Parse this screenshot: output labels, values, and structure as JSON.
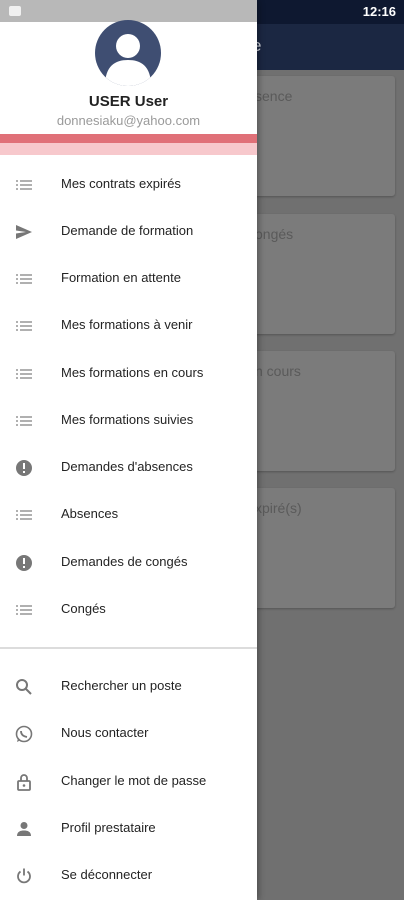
{
  "status": {
    "time": "12:16"
  },
  "app": {
    "title_fragment": "e",
    "cards": [
      {
        "title": "sence"
      },
      {
        "title": "ongés"
      },
      {
        "title": "n cours"
      },
      {
        "title": "xpiré(s)"
      }
    ]
  },
  "drawer": {
    "user_name": "USER User",
    "user_email": "donnesiaku@yahoo.com",
    "accent_colors": [
      "#e07078",
      "#f7c8cc"
    ],
    "menu": [
      {
        "label": "Mes contrats expirés",
        "icon": "list-icon"
      },
      {
        "label": "Demande de formation",
        "icon": "send-icon"
      },
      {
        "label": "Formation en attente",
        "icon": "list-icon"
      },
      {
        "label": "Mes formations à venir",
        "icon": "list-icon"
      },
      {
        "label": "Mes formations en cours",
        "icon": "list-icon"
      },
      {
        "label": "Mes formations suivies",
        "icon": "list-icon"
      },
      {
        "label": "Demandes d'absences",
        "icon": "alert-circle-icon"
      },
      {
        "label": "Absences",
        "icon": "list-icon"
      },
      {
        "label": "Demandes de congés",
        "icon": "alert-circle-icon"
      },
      {
        "label": "Congés",
        "icon": "list-icon"
      }
    ],
    "secondary_menu": [
      {
        "label": "Rechercher un poste",
        "icon": "search-icon"
      },
      {
        "label": "Nous contacter",
        "icon": "whatsapp-icon"
      },
      {
        "label": "Changer le mot de passe",
        "icon": "lock-icon"
      },
      {
        "label": "Profil prestataire",
        "icon": "person-icon"
      },
      {
        "label": "Se déconnecter",
        "icon": "power-icon"
      }
    ]
  }
}
